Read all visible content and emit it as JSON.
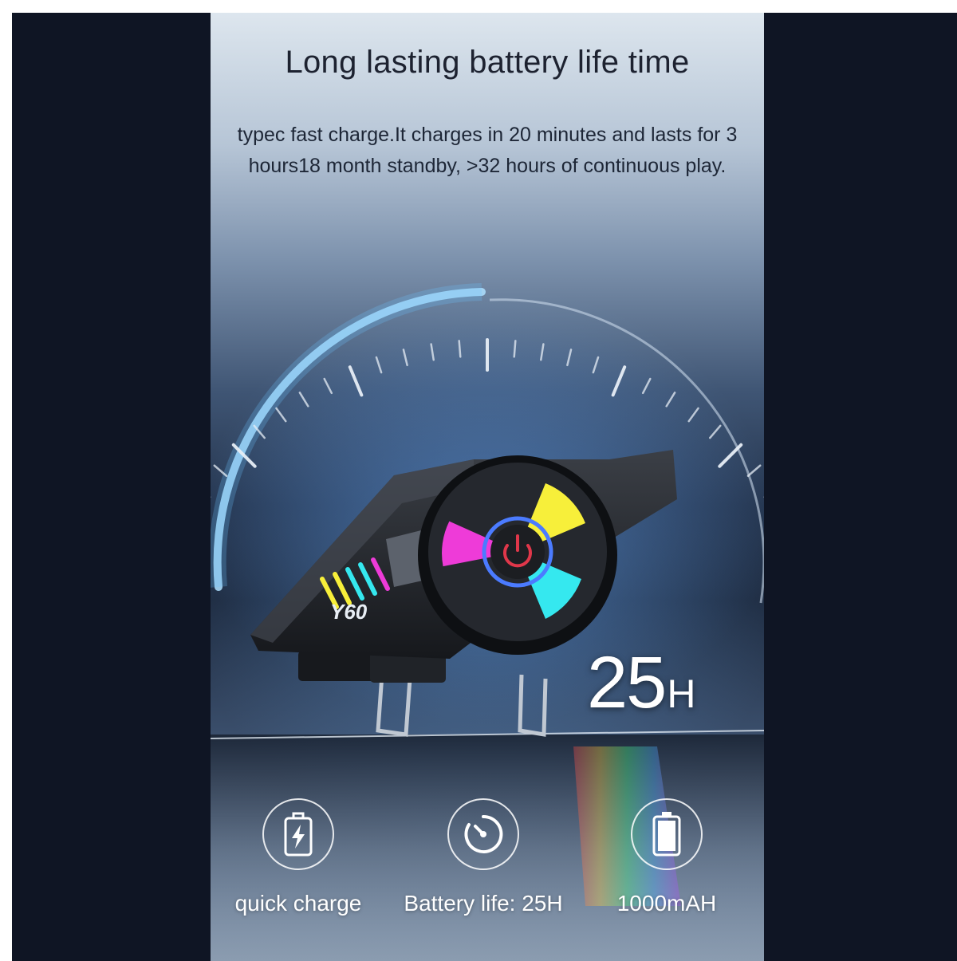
{
  "headline": "Long lasting battery life time",
  "description": "typec fast charge.It charges in 20 minutes and lasts for 3 hours18 month standby, >32 hours of continuous play.",
  "product": {
    "model_mark": "Y60",
    "battery_reading": {
      "value": "25",
      "unit": "H"
    }
  },
  "features": [
    {
      "icon": "battery-charging-icon",
      "label": "quick charge"
    },
    {
      "icon": "timer-icon",
      "label": "Battery life: 25H"
    },
    {
      "icon": "battery-icon",
      "label": "1000mAH"
    }
  ],
  "colors": {
    "outer_background": "#0f1524",
    "button_yellow": "#f7ef3a",
    "button_magenta": "#ee3bd8",
    "button_cyan": "#35e8ef",
    "power_red": "#e0374a"
  }
}
